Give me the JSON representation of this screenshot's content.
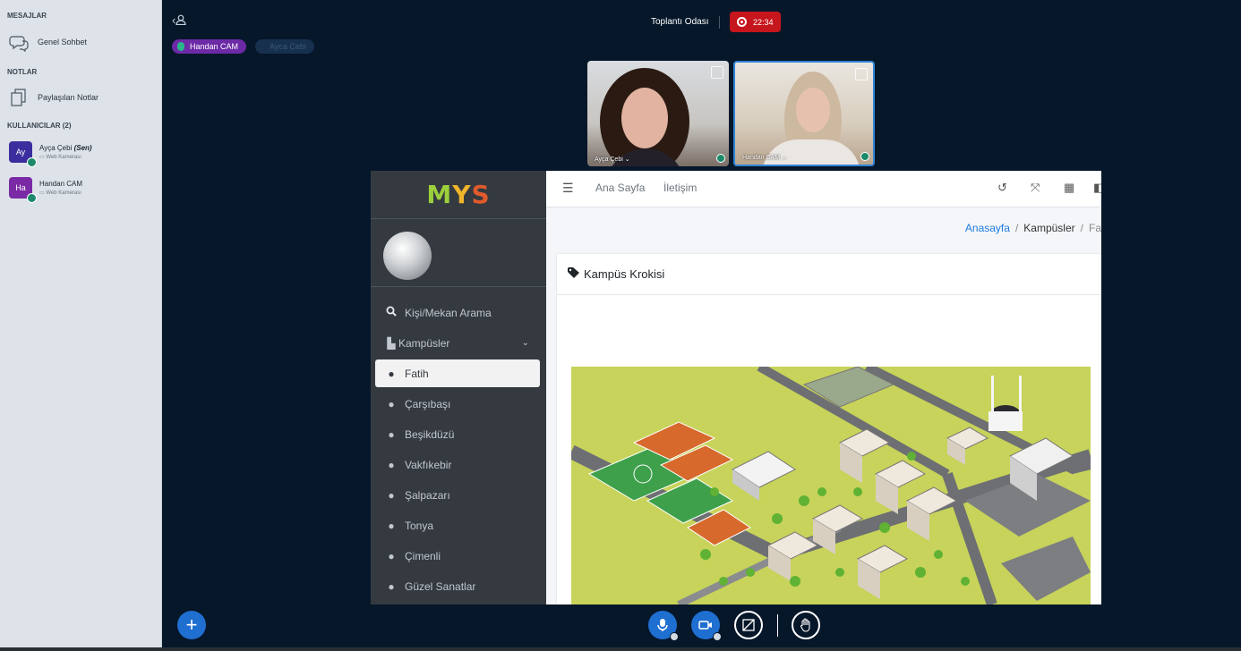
{
  "sidebar": {
    "messages_title": "MESAJLAR",
    "public_chat": "Genel Sohbet",
    "notes_title": "NOTLAR",
    "shared_notes": "Paylaşılan Notlar",
    "users_title": "KULLANICILAR (2)",
    "users": [
      {
        "initials": "Ay",
        "name": "Ayça Çebi",
        "you": "(Sen)",
        "sub": "Web Kamerası",
        "color": "#3a2e9e"
      },
      {
        "initials": "Ha",
        "name": "Handan CAM",
        "sub": "Web Kamerası",
        "color": "#7b2aa6"
      }
    ]
  },
  "header": {
    "room_title": "Toplantı Odası",
    "recording_time": "22:34"
  },
  "talkers": [
    {
      "name": "Handan CAM",
      "active": true
    },
    {
      "name": "Ayca Cebi",
      "active": false
    }
  ],
  "webcams": [
    {
      "name": "Ayça Çebi"
    },
    {
      "name": "Handan CAM"
    }
  ],
  "screen": {
    "logo": {
      "m": "M",
      "y": "Y",
      "s": "S"
    },
    "nav_top": {
      "home": "Ana Sayfa",
      "contact": "İletişim"
    },
    "search": "Kişi/Mekan Arama",
    "campuses": "Kampüsler",
    "campus_items": [
      "Fatih",
      "Çarşıbaşı",
      "Beşikdüzü",
      "Vakfıkebir",
      "Şalpazarı",
      "Tonya",
      "Çimenli",
      "Güzel Sanatlar"
    ],
    "breadcrumb": {
      "home": "Anasayfa",
      "campuses": "Kampüsler",
      "current": "Fa"
    },
    "card_title": "Kampüs Krokisi"
  },
  "colors": {
    "background": "#06172a",
    "accent_blue": "#1f6fd1",
    "recording_red": "#c6161d",
    "talker_purple": "#6c2aa6"
  }
}
